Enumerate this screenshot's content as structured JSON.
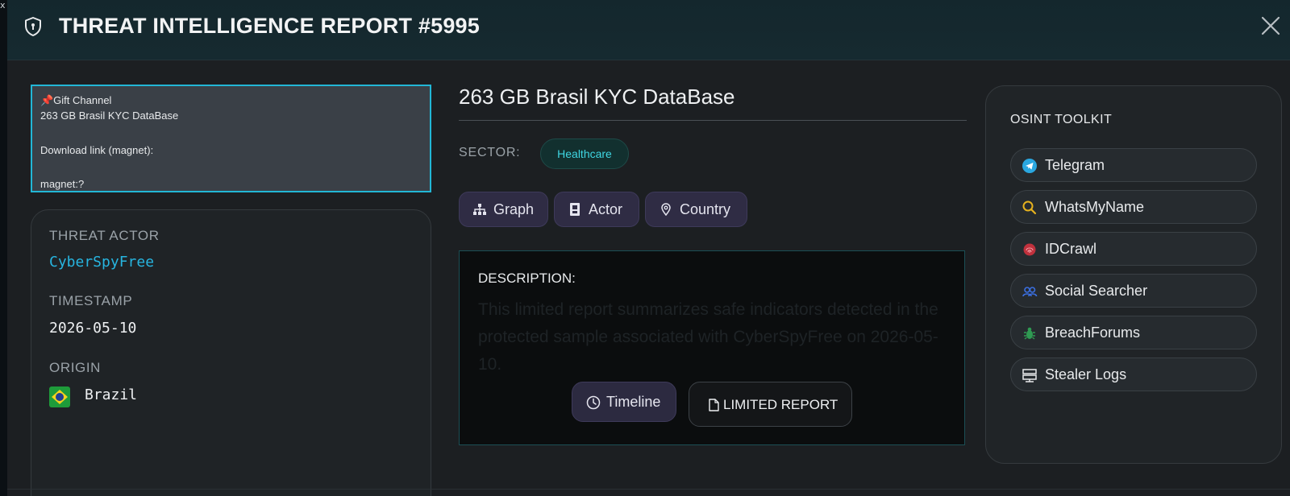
{
  "corner_mark": "x",
  "header": {
    "title": "THREAT INTELLIGENCE REPORT #5995"
  },
  "preview": {
    "channel": "📌Gift Channel",
    "line2": "263 GB Brasil KYC DataBase",
    "line3": "Download link (magnet):",
    "line4": "magnet:?"
  },
  "info": {
    "actor_label": "THREAT ACTOR",
    "actor_value": "CyberSpyFree",
    "timestamp_label": "TIMESTAMP",
    "timestamp_value": "2026-05-10",
    "origin_label": "ORIGIN",
    "origin_value": "Brazil"
  },
  "report": {
    "name": "263 GB Brasil KYC DataBase",
    "sector_label": "SECTOR:",
    "sector_value": "Healthcare"
  },
  "actions": {
    "graph": "Graph",
    "actor": "Actor",
    "country": "Country"
  },
  "description": {
    "label": "DESCRIPTION:",
    "text": "This limited report summarizes safe indicators detected in the protected sample associated with CyberSpyFree on 2026-05-10.",
    "timeline_label": "Timeline",
    "limited_label": "LIMITED REPORT"
  },
  "toolkit": {
    "title": "OSINT TOOLKIT",
    "tools": [
      {
        "label": "Telegram",
        "icon": "telegram-icon"
      },
      {
        "label": "WhatsMyName",
        "icon": "search-icon"
      },
      {
        "label": "IDCrawl",
        "icon": "fingerprint-icon"
      },
      {
        "label": "Social Searcher",
        "icon": "users-icon"
      },
      {
        "label": "BreachForums",
        "icon": "bug-icon"
      },
      {
        "label": "Stealer Logs",
        "icon": "server-icon"
      }
    ]
  },
  "colors": {
    "accent_cyan": "#22b7d6",
    "actor_link": "#27b5e0",
    "sector_tag": "#3fd6e2",
    "pill_bg": "#2f2c44"
  }
}
